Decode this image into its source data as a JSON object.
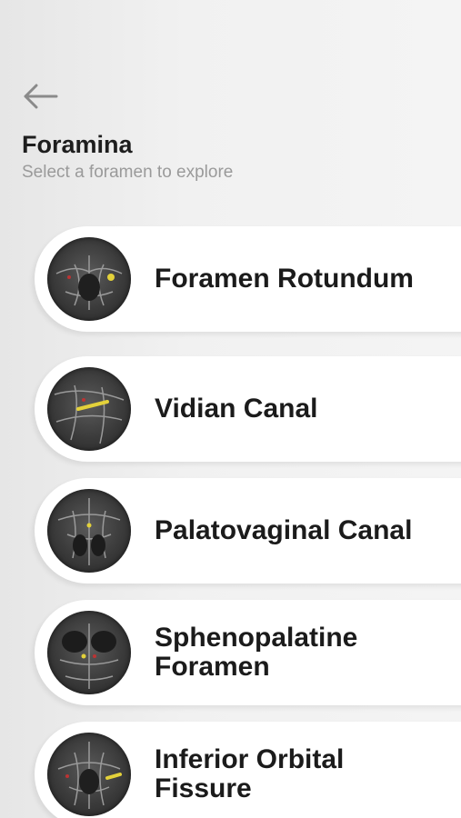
{
  "header": {
    "back_icon": "arrow-left-icon",
    "title": "Foramina",
    "subtitle": "Select a foramen to explore"
  },
  "items": [
    {
      "label": "Foramen Rotundum",
      "icon": "anatomy-thumbnail"
    },
    {
      "label": "Vidian Canal",
      "icon": "anatomy-thumbnail"
    },
    {
      "label": "Palatovaginal Canal",
      "icon": "anatomy-thumbnail"
    },
    {
      "label": "Sphenopalatine Foramen",
      "icon": "anatomy-thumbnail"
    },
    {
      "label": "Inferior Orbital Fissure",
      "icon": "anatomy-thumbnail"
    }
  ],
  "colors": {
    "background": "#f0f0f0",
    "card": "#ffffff",
    "title": "#1e1e1e",
    "subtitle": "#9a9a9a",
    "highlight": "#e3d13a"
  }
}
